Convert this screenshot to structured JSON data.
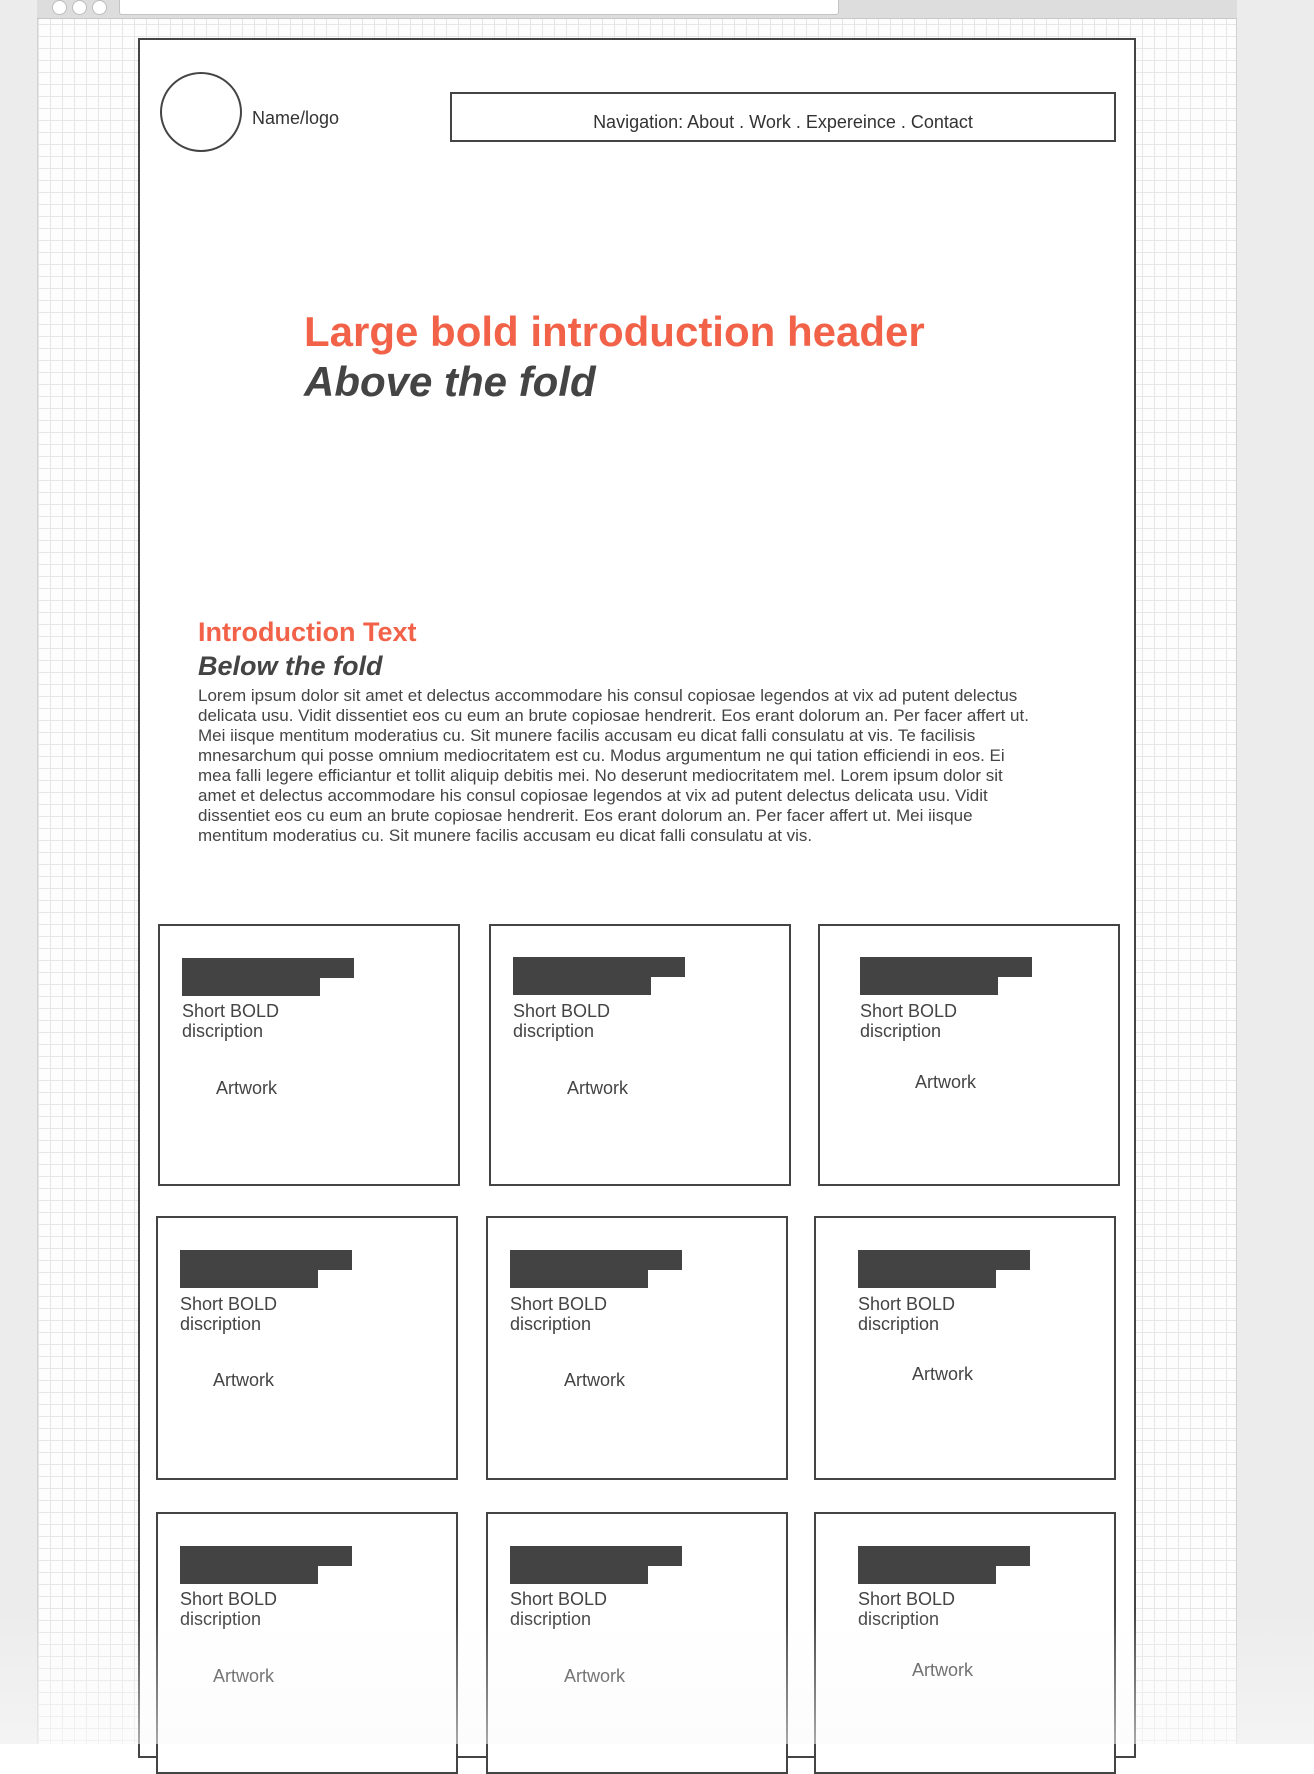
{
  "header": {
    "logo_text": "Name/logo",
    "navigation": "Navigation: About .  Work . Expereince . Contact"
  },
  "hero": {
    "title": "Large bold introduction header",
    "subtitle": "Above the fold"
  },
  "intro": {
    "title": "Introduction Text",
    "subtitle": "Below the fold",
    "body": "Lorem ipsum dolor sit amet et delectus accommodare his consul copiosae legendos at vix ad putent delectus delicata usu. Vidit dissentiet eos cu eum an brute copiosae hendrerit. Eos erant dolorum an. Per facer affert ut. Mei iisque mentitum moderatius cu. Sit munere facilis accusam eu dicat falli consulatu at vis. Te facilisis mnesarchum qui posse omnium mediocritatem est cu. Modus argumentum ne qui tation efficiendi in eos. Ei mea falli legere efficiantur et tollit aliquip debitis mei. No deserunt mediocritatem mel. Lorem ipsum dolor sit amet et delectus accommodare his consul copiosae legendos at vix ad putent delectus delicata usu. Vidit dissentiet eos cu eum an brute copiosae hendrerit. Eos erant dolorum an. Per facer affert ut. Mei iisque mentitum moderatius cu. Sit munere facilis accusam eu dicat falli consulatu at vis."
  },
  "cards": [
    {
      "description": "Short BOLD discription",
      "artwork": "Artwork"
    },
    {
      "description": "Short BOLD discription",
      "artwork": "Artwork"
    },
    {
      "description": "Short BOLD discription",
      "artwork": "Artwork"
    },
    {
      "description": "Short BOLD discription",
      "artwork": "Artwork"
    },
    {
      "description": "Short BOLD discription",
      "artwork": "Artwork"
    },
    {
      "description": "Short BOLD discription",
      "artwork": "Artwork"
    },
    {
      "description": "Short BOLD discription",
      "artwork": "Artwork"
    },
    {
      "description": "Short BOLD discription",
      "artwork": "Artwork"
    },
    {
      "description": "Short BOLD discription",
      "artwork": "Artwork"
    }
  ],
  "colors": {
    "accent": "#f26249",
    "text": "#444444",
    "placeholder_bar": "#434343"
  }
}
